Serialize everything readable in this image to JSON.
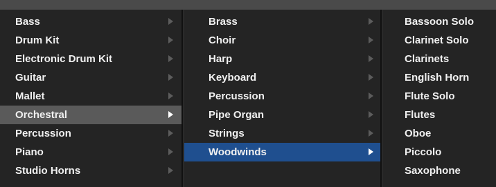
{
  "menu_level_1": {
    "items": [
      {
        "label": "Bass"
      },
      {
        "label": "Drum Kit"
      },
      {
        "label": "Electronic Drum Kit"
      },
      {
        "label": "Guitar"
      },
      {
        "label": "Mallet"
      },
      {
        "label": "Orchestral"
      },
      {
        "label": "Percussion"
      },
      {
        "label": "Piano"
      },
      {
        "label": "Studio Horns"
      }
    ],
    "selected": "Orchestral"
  },
  "menu_level_2": {
    "items": [
      {
        "label": "Brass"
      },
      {
        "label": "Choir"
      },
      {
        "label": "Harp"
      },
      {
        "label": "Keyboard"
      },
      {
        "label": "Percussion"
      },
      {
        "label": "Pipe Organ"
      },
      {
        "label": "Strings"
      },
      {
        "label": "Woodwinds"
      }
    ],
    "selected": "Woodwinds"
  },
  "menu_level_3": {
    "items": [
      {
        "label": "Bassoon Solo"
      },
      {
        "label": "Clarinet Solo"
      },
      {
        "label": "Clarinets"
      },
      {
        "label": "English Horn"
      },
      {
        "label": "Flute Solo"
      },
      {
        "label": "Flutes"
      },
      {
        "label": "Oboe"
      },
      {
        "label": "Piccolo"
      },
      {
        "label": "Saxophone"
      }
    ]
  },
  "colors": {
    "menu_background": "#242424",
    "highlight_grey": "#5a5a5a",
    "highlight_blue": "#1f4f8f",
    "text": "#f0f0f0",
    "submenu_arrow": "#5c5c5c"
  },
  "icons": {
    "submenu_arrow": "chevron-right-icon"
  }
}
